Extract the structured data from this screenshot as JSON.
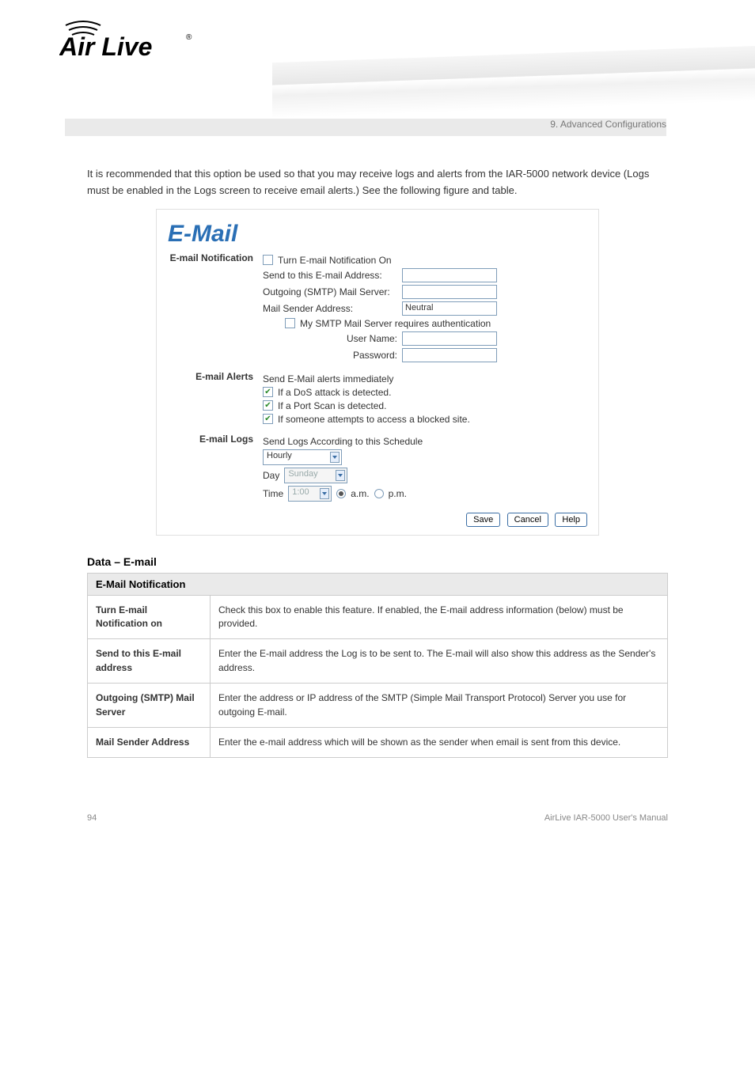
{
  "header": {
    "brand": "Air Live",
    "chapter": "9. Advanced Configurations"
  },
  "intro": {
    "text": "It is recommended that this option be used so that you may receive logs and alerts from the IAR-5000 network device (Logs must be enabled in the Logs screen to receive email alerts.) See the following figure and table."
  },
  "screenshot": {
    "title": "E-Mail",
    "sections": {
      "notification": {
        "label": "E-mail Notification",
        "turn_on": "Turn E-mail Notification On",
        "send_to": "Send to this E-mail Address:",
        "smtp": "Outgoing (SMTP) Mail Server:",
        "sender": "Mail Sender Address:",
        "sender_value": "Neutral",
        "auth_req": "My SMTP Mail Server requires authentication",
        "username": "User Name:",
        "password": "Password:"
      },
      "alerts": {
        "label": "E-mail Alerts",
        "heading": "Send E-Mail alerts immediately",
        "opt1": "If a DoS attack is detected.",
        "opt2": "If a Port Scan is detected.",
        "opt3": "If someone attempts to access a blocked site."
      },
      "logs": {
        "label": "E-mail Logs",
        "heading": "Send Logs According to this Schedule",
        "schedule": "Hourly",
        "day_label": "Day",
        "day_value": "Sunday",
        "time_label": "Time",
        "time_value": "1:00",
        "am": "a.m.",
        "pm": "p.m."
      }
    },
    "buttons": {
      "save": "Save",
      "cancel": "Cancel",
      "help": "Help"
    }
  },
  "datadesc": {
    "heading": "Data – E-mail",
    "table_header": "E-Mail Notification",
    "rows": [
      {
        "name": "Turn E-mail Notification on",
        "desc": "Check this box to enable this feature. If enabled, the E-mail address information (below) must be provided."
      },
      {
        "name": "Send to this E-mail address",
        "desc": "Enter the E-mail address the Log is to be sent to. The E-mail will also show this address as the Sender's address."
      },
      {
        "name": "Outgoing (SMTP) Mail Server",
        "desc": "Enter the address or IP address of the SMTP (Simple Mail Transport Protocol) Server you use for outgoing E-mail."
      },
      {
        "name": "Mail Sender Address",
        "desc": "Enter the e-mail address which will be shown as the sender when email is sent from this device."
      }
    ]
  },
  "footer": {
    "page": "94",
    "product": "AirLive IAR-5000 User's Manual"
  }
}
